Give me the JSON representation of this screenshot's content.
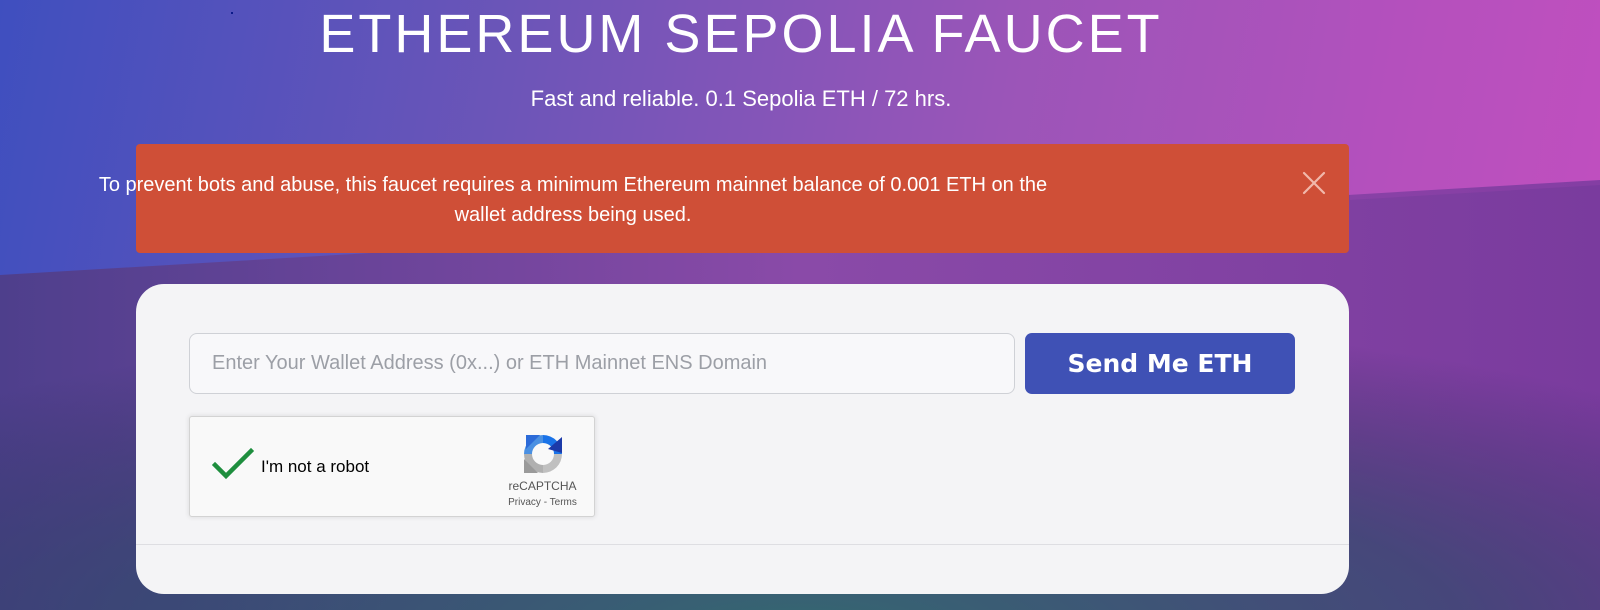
{
  "header": {
    "title": "ETHEREUM SEPOLIA FAUCET",
    "subtitle": "Fast and reliable. 0.1 Sepolia ETH / 72 hrs."
  },
  "alert": {
    "line1": "To prevent bots and abuse, this faucet requires a minimum Ethereum mainnet balance of 0.001 ETH on the",
    "line2": "wallet address being used.",
    "close_icon": "close-icon"
  },
  "form": {
    "address_placeholder": "Enter Your Wallet Address (0x...) or ETH Mainnet ENS Domain",
    "address_value": "",
    "send_label": "Send Me ETH"
  },
  "recaptcha": {
    "checked": true,
    "label": "I'm not a robot",
    "brand": "reCAPTCHA",
    "privacy": "Privacy",
    "separator": " - ",
    "terms": "Terms"
  },
  "colors": {
    "alert_bg": "#cf4f37",
    "button_bg": "#3f51b5",
    "check": "#1e8e3e"
  }
}
